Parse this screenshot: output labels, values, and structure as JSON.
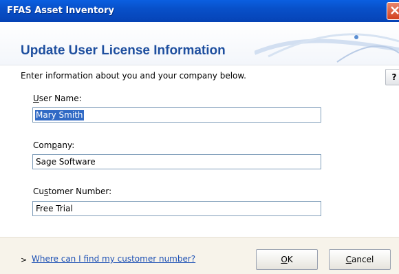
{
  "window": {
    "title": "FFAS Asset Inventory"
  },
  "header": {
    "title": "Update User License Information"
  },
  "intro": "Enter information about you and your company below.",
  "help_label": "?",
  "fields": {
    "user_name": {
      "label_mnemonic": "U",
      "label_rest": "ser Name:",
      "value": "Mary Smith"
    },
    "company": {
      "label_pre": "Com",
      "label_mnemonic": "p",
      "label_rest": "any:",
      "value": "Sage Software"
    },
    "customer_number": {
      "label_pre": "Cu",
      "label_mnemonic": "s",
      "label_rest": "tomer Number:",
      "value": "Free Trial"
    }
  },
  "footer": {
    "chevron": ">",
    "link": "Where can I find my customer number?",
    "ok": {
      "mnemonic": "O",
      "rest": "K"
    },
    "cancel": {
      "mnemonic": "C",
      "rest": "ancel"
    }
  },
  "colors": {
    "titlebar": "#0850c9",
    "header_title": "#1e4f9f",
    "selection": "#316ac5",
    "link": "#1b4fb4"
  }
}
